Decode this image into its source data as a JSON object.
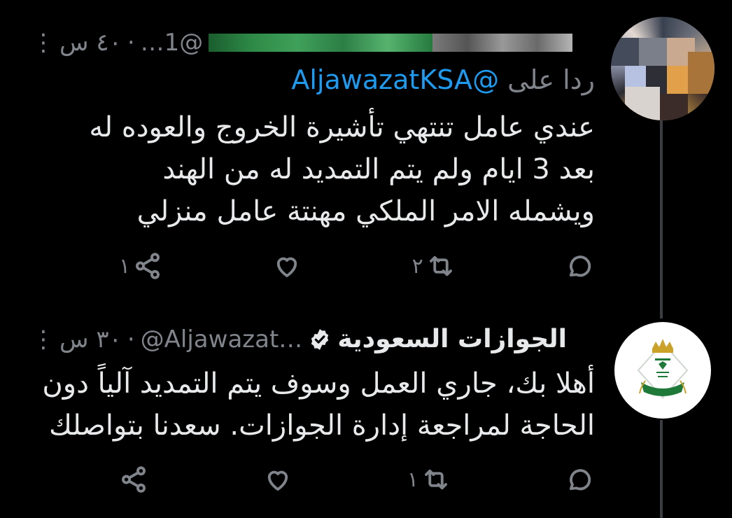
{
  "tweet1": {
    "handle": "…1@",
    "time": "٤٠ س",
    "reply_prefix": "ردا على",
    "reply_handle": "@AljawazatKSA",
    "lines": [
      "عندي عامل تنتهي تأشيرة الخروج والعوده له",
      "بعد 3 ايام ولم يتم التمديد  له من الهند",
      "ويشمله الامر الملكي مهنتة عامل  منزلي"
    ],
    "share_count": "١",
    "retweet_count": "٢"
  },
  "tweet2": {
    "display_name": "الجوازات السعودية",
    "handle": "@Aljawazat…",
    "time": "٣٠ س",
    "lines": [
      "أهلا بك، جاري العمل وسوف يتم التمديد آلياً دون",
      "الحاجة لمراجعة إدارة الجوازات. سعدنا بتواصلك"
    ],
    "retweet_count": "١"
  },
  "icons": {
    "more": "more-options-icon",
    "share": "share-icon",
    "like": "heart-icon",
    "retweet": "retweet-icon",
    "reply": "reply-icon",
    "verified": "verified-badge-icon"
  },
  "colors": {
    "background": "#000000",
    "text": "#e7e9ea",
    "muted": "#80858c",
    "link": "#1d9bf0",
    "thread_line": "#3a3d41",
    "logo_green": "#1f7a3a",
    "logo_gold": "#c9a227"
  }
}
